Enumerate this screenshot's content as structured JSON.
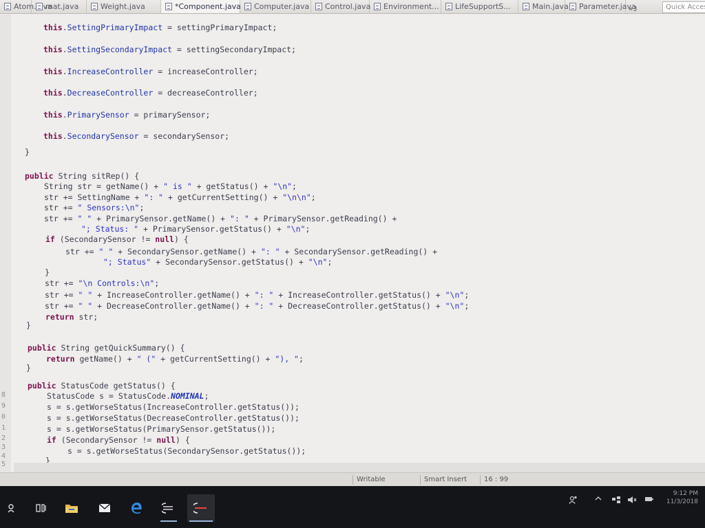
{
  "tabs": [
    {
      "label": "Atom.java",
      "active": false,
      "dirty": false
    },
    {
      "label": "mat.java",
      "active": false,
      "dirty": false
    },
    {
      "label": "Weight.java",
      "active": false,
      "dirty": false
    },
    {
      "label": "*Component.java",
      "active": true,
      "dirty": true
    },
    {
      "label": "Computer.java",
      "active": false,
      "dirty": false
    },
    {
      "label": "Control.java",
      "active": false,
      "dirty": false
    },
    {
      "label": "Environment...",
      "active": false,
      "dirty": false
    },
    {
      "label": "LifeSupportS...",
      "active": false,
      "dirty": false
    },
    {
      "label": "Main.java",
      "active": false,
      "dirty": false
    },
    {
      "label": "Parameter.java",
      "active": false,
      "dirty": false
    }
  ],
  "tab_close_glyph": "✕",
  "tab_overflow": "»3",
  "quick_access": "Quick Access",
  "code": [
    "        this.SettingPrimaryImpact = settingPrimaryImpact;",
    "        this.SettingSecondaryImpact = settingSecondaryImpact;",
    "        this.IncreaseController = increaseController;",
    "        this.DecreaseController = decreaseController;",
    "        this.PrimarySensor = primarySensor;",
    "        this.SecondarySensor = secondarySensor;",
    "    }",
    "    public String sitRep() {",
    "        String str = getName() + \" is \" + getStatus() + \"\\n\";",
    "        str += SettingName + \": \" + getCurrentSetting() + \"\\n\\n\";",
    "        str += \" Sensors:\\n\";",
    "        str += \" \" + PrimarySensor.getName() + \": \" + PrimarySensor.getReading() +",
    "            \"; Status: \" + PrimarySensor.getStatus() + \"\\n\";",
    "        if (SecondarySensor != null) {",
    "            str += \" \" + SecondarySensor.getName() + \": \" + SecondarySensor.getReading() +",
    "                \"; Status\" + SecondarySensor.getStatus() + \"\\n\";",
    "        }",
    "        str += \"\\n Controls:\\n\";",
    "        str += \" \" + IncreaseController.getName() + \": \" + IncreaseController.getStatus() + \"\\n\";",
    "        str += \" \" + DecreaseController.getName() + \": \" + DecreaseController.getStatus() + \"\\n\";",
    "        return str;",
    "    }",
    "    public String getQuickSummary() {",
    "        return getName() + \" (\" + getCurrentSetting() + \"), \";",
    "    }",
    "    public StatusCode getStatus() {",
    "        StatusCode s = StatusCode.NOMINAL;",
    "        s = s.getWorseStatus(IncreaseController.getStatus());",
    "        s = s.getWorseStatus(DecreaseController.getStatus());",
    "        s = s.getWorseStatus(PrimarySensor.getStatus());",
    "        if (SecondarySensor != null) {",
    "            s = s.getWorseStatus(SecondarySensor.getStatus());",
    "        }",
    "    ."
  ],
  "line_numbers": [
    "8",
    "9",
    "0",
    "1",
    "2",
    "3",
    "4",
    "5"
  ],
  "status": {
    "writable": "Writable",
    "insert_mode": "Smart Insert",
    "cursor": "16 : 99"
  },
  "taskbar": {
    "clock_time": "9:12 PM",
    "clock_date": "11/3/2018"
  },
  "colors": {
    "keyword": "#7c1350",
    "field": "#2333a8",
    "string": "#2f32c7",
    "editor_bg": "#efeeec",
    "taskbar_bg": "#141518"
  },
  "icons": [
    "java-file-icon",
    "cortana-icon",
    "task-view-icon",
    "file-explorer-icon",
    "mail-icon",
    "edge-icon",
    "eclipse-icon",
    "people-icon",
    "network-icon",
    "volume-icon",
    "battery-icon"
  ]
}
